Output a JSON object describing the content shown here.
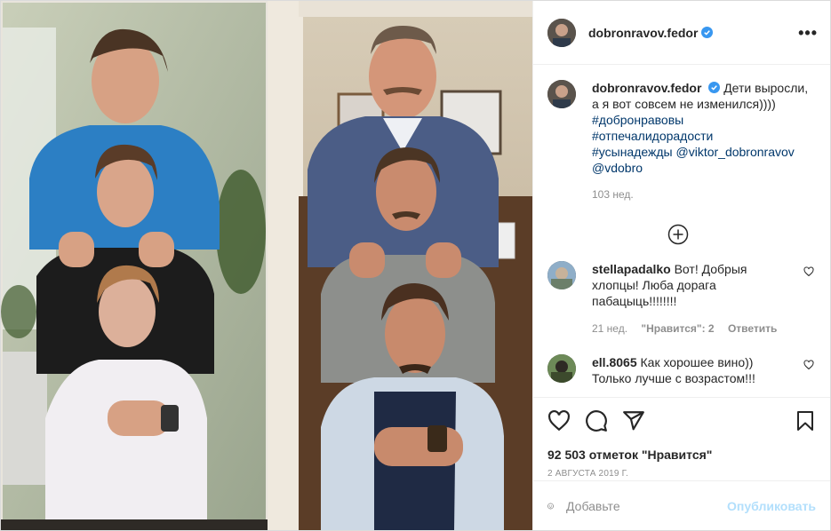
{
  "post": {
    "username": "dobronravov.fedor",
    "more_label": "•••",
    "caption": {
      "username": "dobronravov.fedor",
      "text": "Дети выросли, а я вот совсем не изменился))))",
      "hashtags": [
        "#добронравовы",
        "#отпечалидорадости",
        "#усынадежды"
      ],
      "mentions": [
        "@viktor_dobronravov",
        "@vdobro"
      ],
      "time": "103 нед."
    },
    "comments": [
      {
        "username": "stellapadalko",
        "text": "Вот! Добрыя хлопцы! Люба дорага пабацыць!!!!!!!!",
        "time": "21 нед.",
        "likes": "\"Нравится\": 2",
        "reply": "Ответить"
      },
      {
        "username": "ell.8065",
        "text": "Как хорошее вино)) Только лучше с возрастом!!!",
        "time": "",
        "likes": "",
        "reply": ""
      }
    ],
    "likes_text": "92 503 отметок \"Нравится\"",
    "date": "2 августа 2019 г.",
    "comment_placeholder": "Добавьте",
    "publish_label": "Опубликовать"
  },
  "colors": {
    "link": "#00376b",
    "verified": "#3897f0",
    "publish_disabled": "#b2dffc",
    "meta": "#8e8e8e"
  },
  "icons": [
    "verified-badge-icon",
    "more-options-icon",
    "load-more-icon",
    "heart-icon",
    "comment-icon",
    "share-icon",
    "bookmark-icon",
    "emoji-icon"
  ]
}
